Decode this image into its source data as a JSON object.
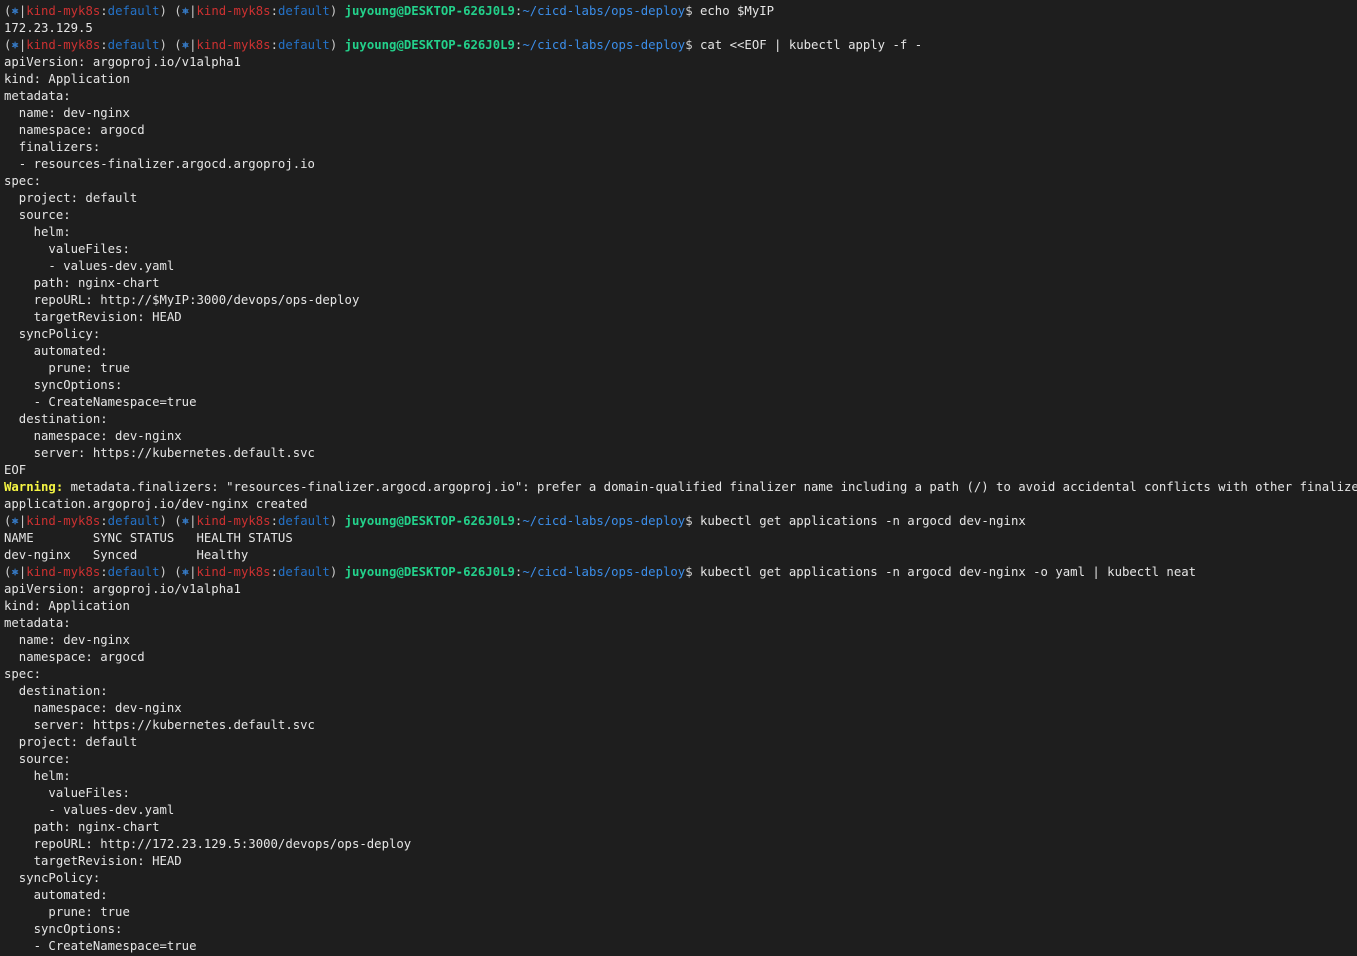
{
  "colors": {
    "background": "#1e1e1e",
    "text": "#cccccc",
    "kube_symbol": "#3b8eea",
    "context": "#cd3131",
    "namespace": "#2472c8",
    "user_host": "#23d18b",
    "path": "#3b8eea",
    "warning": "#f5f543"
  },
  "prompt": {
    "kube_icon": "⎈",
    "context": "kind-myk8s",
    "namespace": "default",
    "user_host": "juyoung@DESKTOP-626J0L9",
    "cwd": "~/cicd-labs/ops-deploy"
  },
  "lines": [
    {
      "type": "prompt",
      "cmd": "echo $MyIP"
    },
    {
      "type": "out",
      "text": "172.23.129.5"
    },
    {
      "type": "prompt",
      "cmd": "cat <<EOF | kubectl apply -f -"
    },
    {
      "type": "out",
      "text": "apiVersion: argoproj.io/v1alpha1"
    },
    {
      "type": "out",
      "text": "kind: Application"
    },
    {
      "type": "out",
      "text": "metadata:"
    },
    {
      "type": "out",
      "text": "  name: dev-nginx"
    },
    {
      "type": "out",
      "text": "  namespace: argocd"
    },
    {
      "type": "out",
      "text": "  finalizers:"
    },
    {
      "type": "out",
      "text": "  - resources-finalizer.argocd.argoproj.io"
    },
    {
      "type": "out",
      "text": "spec:"
    },
    {
      "type": "out",
      "text": "  project: default"
    },
    {
      "type": "out",
      "text": "  source:"
    },
    {
      "type": "out",
      "text": "    helm:"
    },
    {
      "type": "out",
      "text": "      valueFiles:"
    },
    {
      "type": "out",
      "text": "      - values-dev.yaml"
    },
    {
      "type": "out",
      "text": "    path: nginx-chart"
    },
    {
      "type": "out",
      "text": "    repoURL: http://$MyIP:3000/devops/ops-deploy"
    },
    {
      "type": "out",
      "text": "    targetRevision: HEAD"
    },
    {
      "type": "out",
      "text": "  syncPolicy:"
    },
    {
      "type": "out",
      "text": "    automated:"
    },
    {
      "type": "out",
      "text": "      prune: true"
    },
    {
      "type": "out",
      "text": "    syncOptions:"
    },
    {
      "type": "out",
      "text": "    - CreateNamespace=true"
    },
    {
      "type": "out",
      "text": "  destination:"
    },
    {
      "type": "out",
      "text": "    namespace: dev-nginx"
    },
    {
      "type": "out",
      "text": "    server: https://kubernetes.default.svc"
    },
    {
      "type": "out",
      "text": "EOF"
    },
    {
      "type": "warn",
      "label": "Warning:",
      "text": " metadata.finalizers: \"resources-finalizer.argocd.argoproj.io\": prefer a domain-qualified finalizer name including a path (/) to avoid accidental conflicts with other finalizer writers"
    },
    {
      "type": "out",
      "text": "application.argoproj.io/dev-nginx created"
    },
    {
      "type": "prompt",
      "cmd": "kubectl get applications -n argocd dev-nginx"
    },
    {
      "type": "out",
      "text": "NAME        SYNC STATUS   HEALTH STATUS"
    },
    {
      "type": "out",
      "text": "dev-nginx   Synced        Healthy"
    },
    {
      "type": "prompt",
      "cmd": "kubectl get applications -n argocd dev-nginx -o yaml | kubectl neat"
    },
    {
      "type": "out",
      "text": "apiVersion: argoproj.io/v1alpha1"
    },
    {
      "type": "out",
      "text": "kind: Application"
    },
    {
      "type": "out",
      "text": "metadata:"
    },
    {
      "type": "out",
      "text": "  name: dev-nginx"
    },
    {
      "type": "out",
      "text": "  namespace: argocd"
    },
    {
      "type": "out",
      "text": "spec:"
    },
    {
      "type": "out",
      "text": "  destination:"
    },
    {
      "type": "out",
      "text": "    namespace: dev-nginx"
    },
    {
      "type": "out",
      "text": "    server: https://kubernetes.default.svc"
    },
    {
      "type": "out",
      "text": "  project: default"
    },
    {
      "type": "out",
      "text": "  source:"
    },
    {
      "type": "out",
      "text": "    helm:"
    },
    {
      "type": "out",
      "text": "      valueFiles:"
    },
    {
      "type": "out",
      "text": "      - values-dev.yaml"
    },
    {
      "type": "out",
      "text": "    path: nginx-chart"
    },
    {
      "type": "out",
      "text": "    repoURL: http://172.23.129.5:3000/devops/ops-deploy"
    },
    {
      "type": "out",
      "text": "    targetRevision: HEAD"
    },
    {
      "type": "out",
      "text": "  syncPolicy:"
    },
    {
      "type": "out",
      "text": "    automated:"
    },
    {
      "type": "out",
      "text": "      prune: true"
    },
    {
      "type": "out",
      "text": "    syncOptions:"
    },
    {
      "type": "out",
      "text": "    - CreateNamespace=true"
    }
  ]
}
